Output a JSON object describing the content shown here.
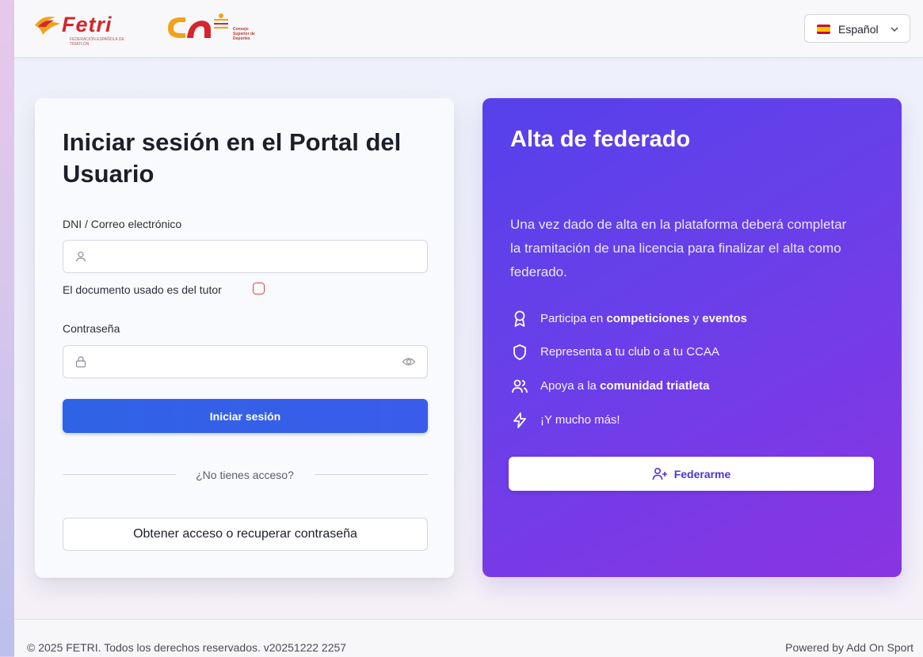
{
  "header": {
    "brand": "Fetri",
    "brand_subtitle": "FEDERACIÓN ESPAÑOLA DE TRIATLÓN",
    "partner_text": "Consejo Superior de Deportes",
    "language": "Español"
  },
  "login": {
    "title": "Iniciar sesión en el Portal del Usuario",
    "dni_label": "DNI / Correo electrónico",
    "dni_value": "",
    "tutor_label": "El documento usado es del tutor",
    "password_label": "Contraseña",
    "password_value": "",
    "submit_label": "Iniciar sesión",
    "divider_text": "¿No tienes acceso?",
    "recover_label": "Obtener acceso o recuperar contraseña"
  },
  "alta": {
    "title": "Alta de federado",
    "description": "Una vez dado de alta en la plataforma deberá completar la tramitación de una licencia para finalizar el alta como federado.",
    "benefits": [
      {
        "icon": "award-icon",
        "pre": "Participa en ",
        "bold1": "competiciones",
        "mid": " y ",
        "bold2": "eventos"
      },
      {
        "icon": "shield-icon",
        "pre": "Representa a tu club o a tu CCAA"
      },
      {
        "icon": "users-icon",
        "pre": "Apoya a la ",
        "bold1": "comunidad triatleta"
      },
      {
        "icon": "zap-icon",
        "pre": "¡Y mucho más!"
      }
    ],
    "button_label": "Federarme"
  },
  "footer": {
    "copyright": "© 2025 FETRI. Todos los derechos reservados. v20251222 2257",
    "powered": "Powered by Add On Sport"
  },
  "colors": {
    "primary": "#3b5cea",
    "alta_gradient_start": "#5641ea",
    "alta_gradient_end": "#8a34e2",
    "brand_red": "#d6262b"
  }
}
